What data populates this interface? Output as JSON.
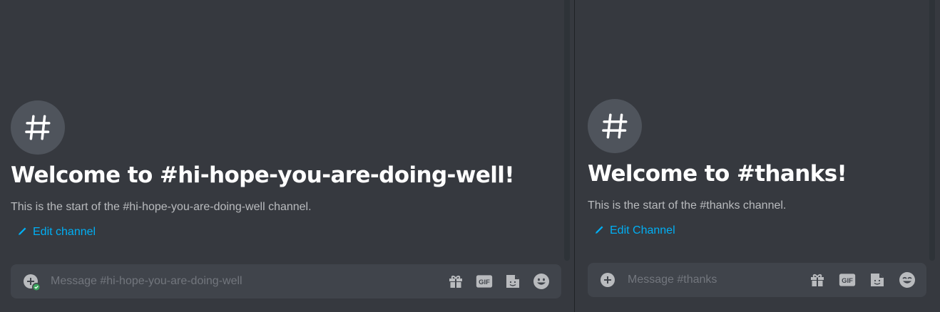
{
  "left": {
    "channel_icon": "hash-icon",
    "welcome": "Welcome to #hi-hope-you-are-doing-well!",
    "subtitle": "This is the start of the #hi-hope-you-are-doing-well channel.",
    "edit_label": "Edit channel",
    "composer": {
      "placeholder": "Message #hi-hope-you-are-doing-well",
      "value": "",
      "icons": [
        "plus-circle-icon",
        "gift-icon",
        "gif-icon",
        "sticker-icon",
        "emoji-icon"
      ]
    }
  },
  "right": {
    "channel_icon": "hash-icon",
    "welcome": "Welcome to #thanks!",
    "subtitle": "This is the start of the #thanks channel.",
    "edit_label": "Edit Channel",
    "composer": {
      "placeholder": "Message #thanks",
      "value": "",
      "icons": [
        "plus-circle-icon",
        "gift-icon",
        "gif-icon",
        "sticker-icon",
        "emoji-icon"
      ]
    }
  },
  "colors": {
    "background": "#36393f",
    "composer": "#40444b",
    "link": "#00aff4",
    "icon": "#b9bbbe",
    "heading": "#ffffff",
    "online_badge": "#3ba55c"
  }
}
